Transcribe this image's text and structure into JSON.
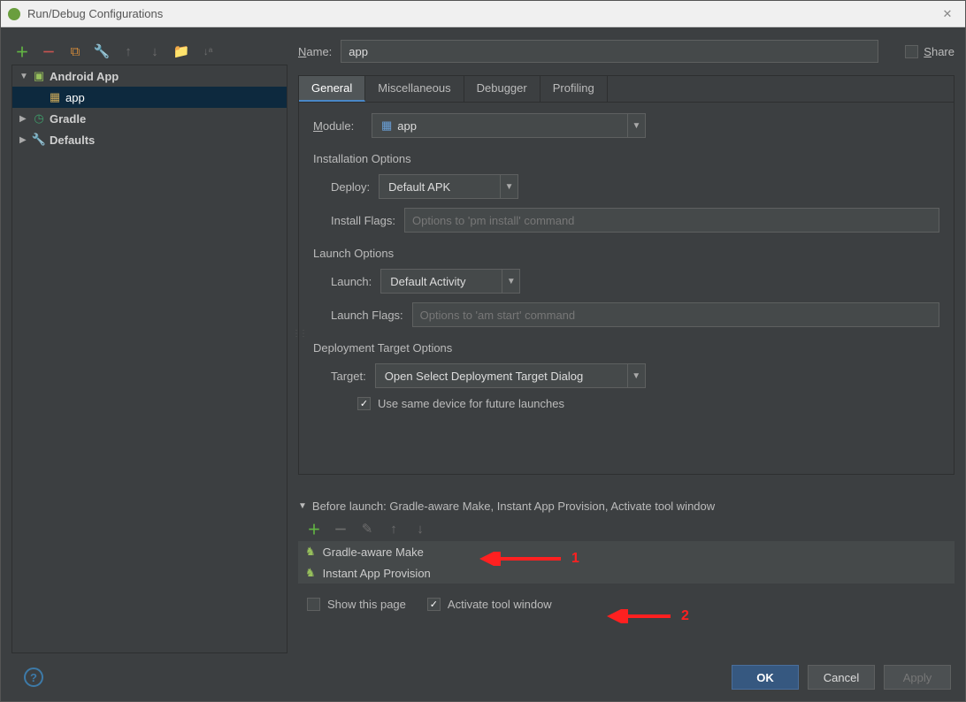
{
  "window": {
    "title": "Run/Debug Configurations",
    "close_glyph": "✕"
  },
  "sidebar": {
    "nodes": {
      "android_app": "Android App",
      "app": "app",
      "gradle": "Gradle",
      "defaults": "Defaults"
    }
  },
  "form": {
    "name_label": "Name:",
    "name_value": "app",
    "share_label": "Share"
  },
  "tabs": {
    "general": "General",
    "misc": "Miscellaneous",
    "debugger": "Debugger",
    "profiling": "Profiling"
  },
  "general": {
    "module_label": "Module:",
    "module_value": "app",
    "installation_header": "Installation Options",
    "deploy_label": "Deploy:",
    "deploy_value": "Default APK",
    "install_flags_label": "Install Flags:",
    "install_flags_placeholder": "Options to 'pm install' command",
    "launch_header": "Launch Options",
    "launch_label": "Launch:",
    "launch_value": "Default Activity",
    "launch_flags_label": "Launch Flags:",
    "launch_flags_placeholder": "Options to 'am start' command",
    "deployment_header": "Deployment Target Options",
    "target_label": "Target:",
    "target_value": "Open Select Deployment Target Dialog",
    "same_device_label": "Use same device for future launches"
  },
  "before_launch": {
    "header": "Before launch: Gradle-aware Make, Instant App Provision, Activate tool window",
    "items": [
      "Gradle-aware Make",
      "Instant App Provision"
    ],
    "show_page_label": "Show this page",
    "activate_label": "Activate tool window"
  },
  "buttons": {
    "ok": "OK",
    "cancel": "Cancel",
    "apply": "Apply"
  },
  "annotations": {
    "one": "1",
    "two": "2"
  }
}
